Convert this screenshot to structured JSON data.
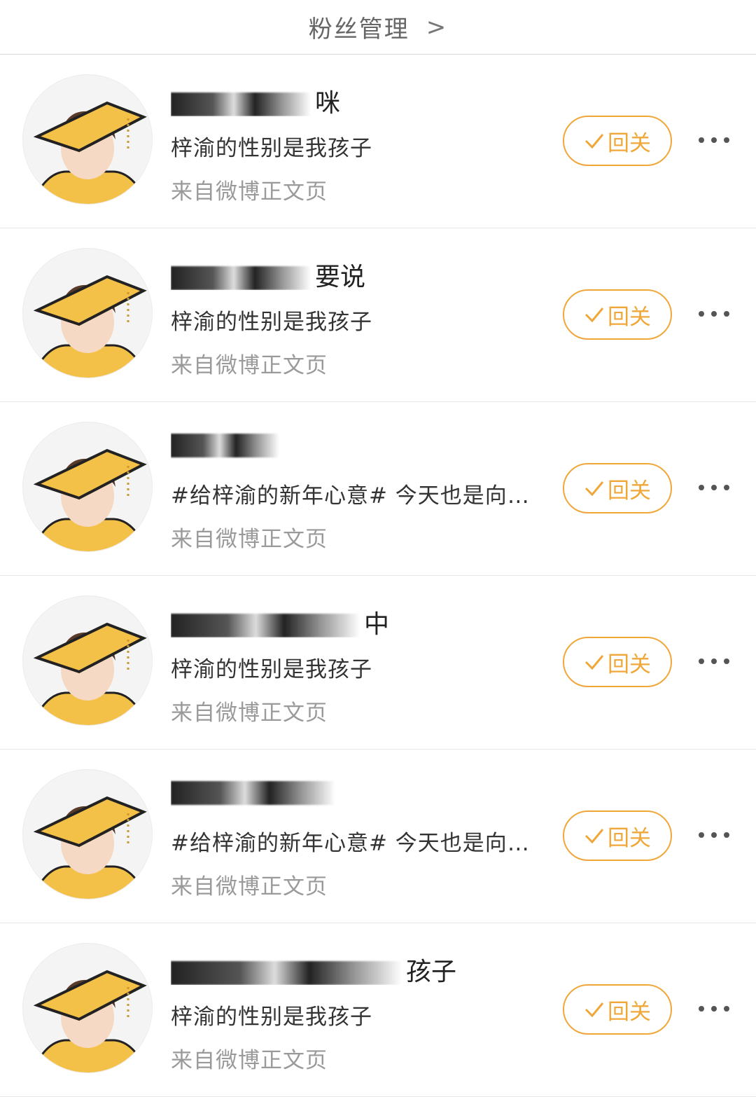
{
  "header": {
    "title": "粉丝管理",
    "chevron": ">"
  },
  "colors": {
    "accent": "#f0a73a",
    "text": "#333333",
    "muted": "#9a9a9a"
  },
  "rows": [
    {
      "name_visible": "咪",
      "desc": "梓渝的性别是我孩子",
      "source": "来自微博正文页",
      "button": "回关"
    },
    {
      "name_visible": "要说",
      "desc": "梓渝的性别是我孩子",
      "source": "来自微博正文页",
      "button": "回关"
    },
    {
      "name_visible": "",
      "desc": "#给梓渝的新年心意# 今天也是向@…",
      "source": "来自微博正文页",
      "button": "回关"
    },
    {
      "name_visible": "中",
      "desc": "梓渝的性别是我孩子",
      "source": "来自微博正文页",
      "button": "回关"
    },
    {
      "name_visible": "",
      "desc": "#给梓渝的新年心意# 今天也是向@…",
      "source": "来自微博正文页",
      "button": "回关"
    },
    {
      "name_visible": "孩子",
      "desc": "梓渝的性别是我孩子",
      "source": "来自微博正文页",
      "button": "回关"
    }
  ],
  "icons": {
    "follow": "check-icon",
    "more": "more-icon"
  }
}
